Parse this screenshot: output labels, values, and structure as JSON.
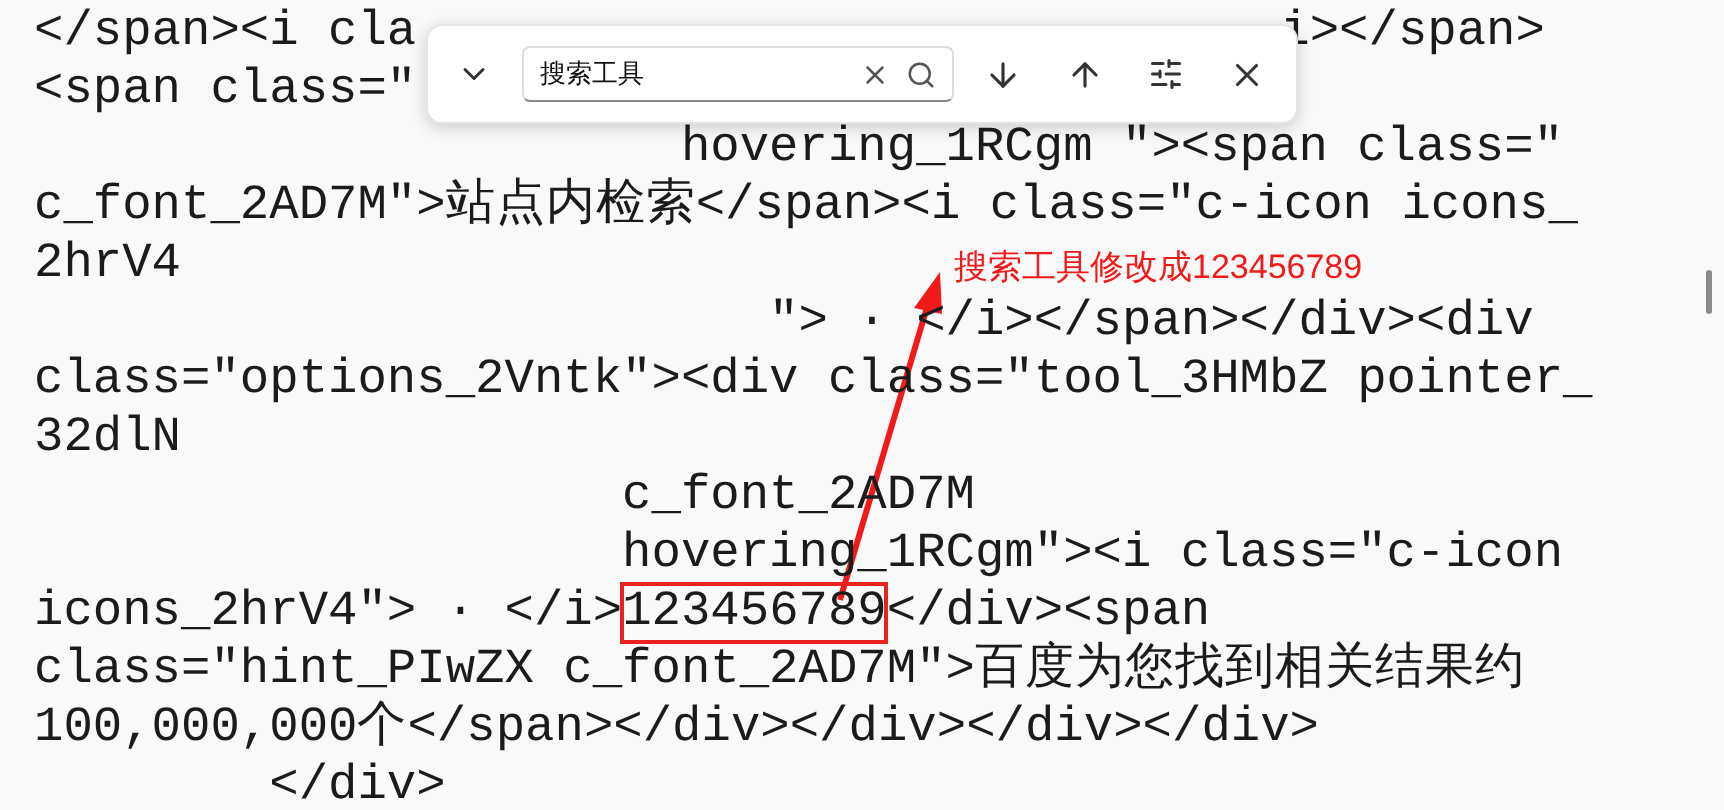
{
  "find_bar": {
    "query": "搜索工具"
  },
  "lines": [
    [
      {
        "kind": "text",
        "text": "</span><i cla"
      },
      {
        "kind": "covered"
      },
      {
        "kind": "text",
        "text": "i></span>"
      }
    ],
    [
      {
        "kind": "text",
        "text": "<span class=\""
      }
    ],
    [
      {
        "kind": "text",
        "text": "                      hovering_1RCgm \"><span class=\""
      }
    ],
    [
      {
        "kind": "text",
        "text": "c_font_2AD7M\">站点内检索</span><i class=\"c-icon icons_"
      }
    ],
    [
      {
        "kind": "text",
        "text": "2hrV4"
      }
    ],
    [
      {
        "kind": "text",
        "text": "                         \"> · </i></span></div><div"
      }
    ],
    [
      {
        "kind": "text",
        "text": "class=\"options_2Vntk\"><div class=\"tool_3HMbZ pointer_"
      }
    ],
    [
      {
        "kind": "text",
        "text": "32dlN"
      }
    ],
    [
      {
        "kind": "text",
        "text": "                    c_font_2AD7M"
      }
    ],
    [
      {
        "kind": "text",
        "text": "                    hovering_1RCgm\"><i class=\"c-icon"
      }
    ],
    [
      {
        "kind": "text",
        "text": "icons_2hrV4\"> · </i>"
      },
      {
        "kind": "highlight",
        "text": "123456789"
      },
      {
        "kind": "text",
        "text": "</div><span"
      }
    ],
    [
      {
        "kind": "text",
        "text": "class=\"hint_PIwZX c_font_2AD7M\">百度为您找到相关结果约"
      }
    ],
    [
      {
        "kind": "text",
        "text": "100,000,000个</span></div></div></div></div>"
      }
    ],
    [
      {
        "kind": "text",
        "text": "        </div>"
      }
    ]
  ],
  "annotation": {
    "text": "搜索工具修改成123456789"
  }
}
